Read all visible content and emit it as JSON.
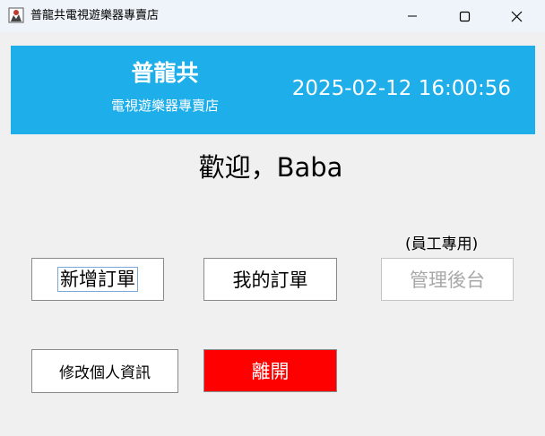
{
  "window": {
    "title": "普龍共電視遊樂器專賣店"
  },
  "header": {
    "brand_name": "普龍共",
    "brand_subtitle": "電視遊樂器專賣店",
    "datetime": "2025-02-12 16:00:56"
  },
  "welcome_text": "歡迎，Baba",
  "staff_only_note": "(員工專用)",
  "buttons": {
    "new_order": "新增訂單",
    "my_orders": "我的訂單",
    "admin_panel": "管理後台",
    "edit_profile": "修改個人資訊",
    "exit": "離開"
  },
  "colors": {
    "header_bg": "#1eaeea",
    "exit_bg": "#ff0000"
  }
}
